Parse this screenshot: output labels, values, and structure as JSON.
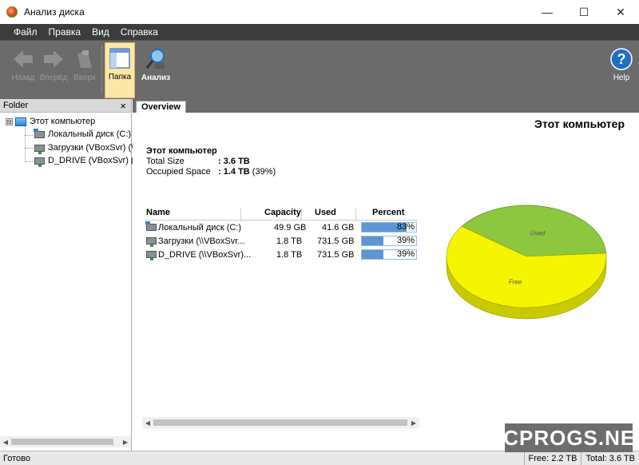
{
  "window": {
    "title": "Анализ диска",
    "minimize": "—",
    "maximize": "☐",
    "close": "✕"
  },
  "menu": [
    "Файл",
    "Правка",
    "Вид",
    "Справка"
  ],
  "toolbar": {
    "back": "Назад",
    "forward": "Вперёд",
    "up": "Вверх",
    "folder": "Папка",
    "analyze": "Анализ",
    "help": "Help"
  },
  "left_panel": {
    "header": "Folder",
    "close": "×",
    "tree": [
      {
        "label": "Этот компьютер",
        "expander": "⊟"
      },
      {
        "label": "Локальный диск (C:)"
      },
      {
        "label": "Загрузки (VBoxSvr) (\\"
      },
      {
        "label": "D_DRIVE (VBoxSvr) (Z:"
      }
    ]
  },
  "tabs": [
    "Overview"
  ],
  "overview": {
    "heading": "Этот компьютер",
    "summary_title": "Этот компьютер",
    "total_size_label": "Total Size",
    "total_size_value": ": 3.6 TB",
    "occupied_label": "Occupied Space",
    "occupied_value": ": 1.4 TB",
    "occupied_pct": "(39%)"
  },
  "table": {
    "headers": {
      "name": "Name",
      "capacity": "Capacity",
      "used": "Used",
      "percent": "Percent"
    },
    "rows": [
      {
        "name": "Локальный диск (C:)",
        "capacity": "49.9 GB",
        "used": "41.6 GB",
        "percent_text": "83%",
        "percent": 83
      },
      {
        "name": "Загрузки (\\\\VBoxSvr...",
        "capacity": "1.8 TB",
        "used": "731.5 GB",
        "percent_text": "39%",
        "percent": 39
      },
      {
        "name": "D_DRIVE (\\\\VBoxSvr)...",
        "capacity": "1.8 TB",
        "used": "731.5 GB",
        "percent_text": "39%",
        "percent": 39
      }
    ]
  },
  "chart_data": {
    "type": "pie",
    "labels": [
      "Used",
      "Free"
    ],
    "values": [
      39,
      61
    ],
    "colors": [
      "#8dc63f",
      "#f5f500"
    ]
  },
  "status": {
    "left": "Готово",
    "free": "Free: 2.2 TB",
    "total": "Total: 3.6 TB"
  },
  "watermark": "PCPROGS.NET"
}
